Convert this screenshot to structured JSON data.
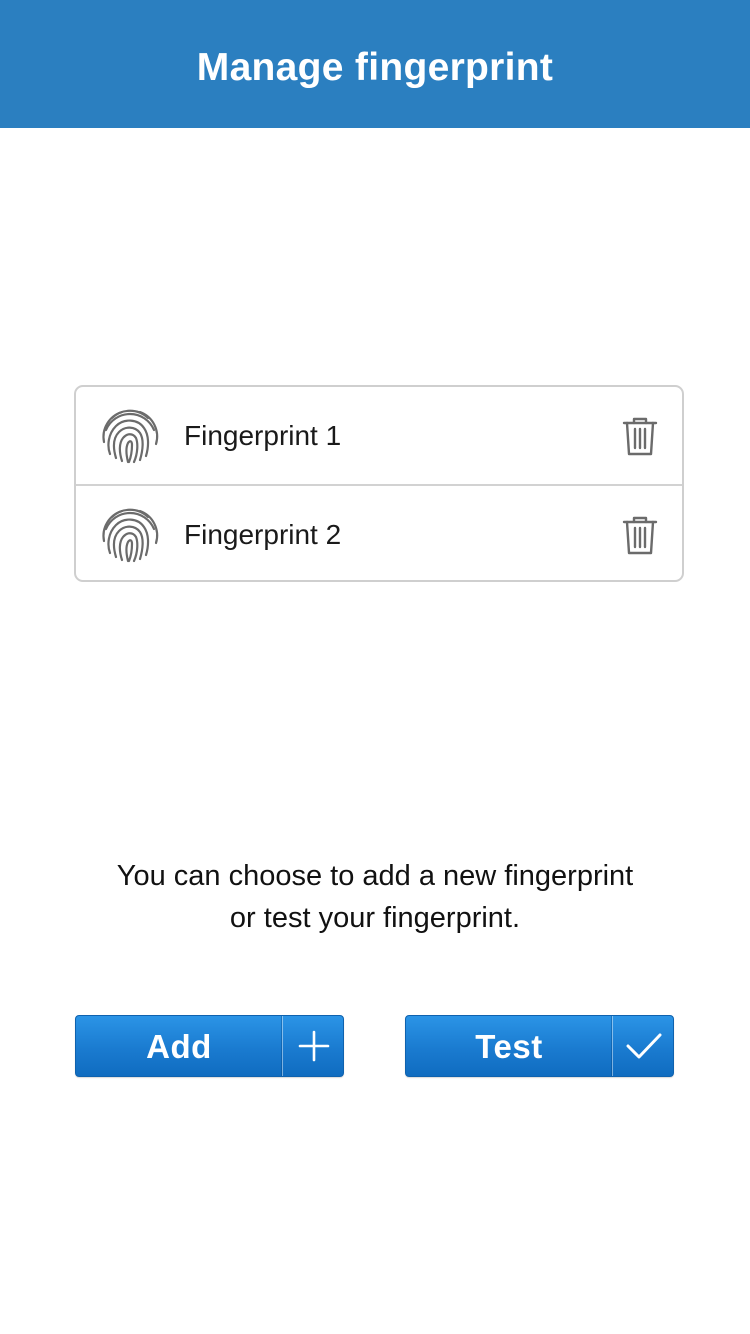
{
  "header": {
    "title": "Manage fingerprint"
  },
  "fingerprints": [
    {
      "label": "Fingerprint 1",
      "icon": "fingerprint-icon",
      "action_icon": "trash-icon"
    },
    {
      "label": "Fingerprint 2",
      "icon": "fingerprint-icon",
      "action_icon": "trash-icon"
    }
  ],
  "hint": {
    "line1": "You can choose to add a new fingerprint",
    "line2": "or test your fingerprint."
  },
  "actions": {
    "add_label": "Add",
    "add_icon": "plus-icon",
    "test_label": "Test",
    "test_icon": "checkmark-icon"
  },
  "colors": {
    "header_bg": "#2b7fc0",
    "button_bg": "#1a7bd0",
    "icon_gray": "#6b6b6b",
    "list_border": "#cfcfcf"
  }
}
